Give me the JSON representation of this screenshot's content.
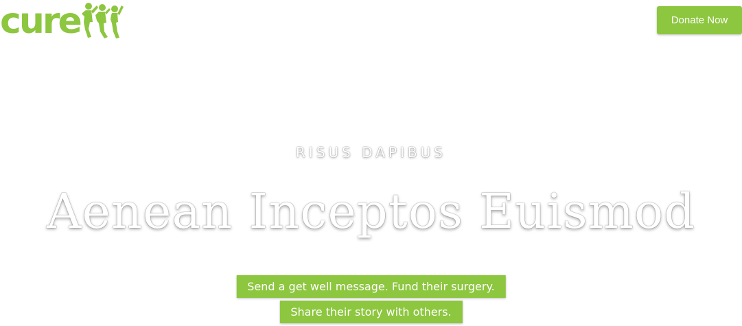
{
  "header": {
    "logo_text": "cure",
    "donate_label": "Donate Now"
  },
  "hero": {
    "kicker": "RISUS DAPIBUS",
    "title": "Aenean Inceptos Euismod",
    "cta_primary": "Send a get well message. Fund their surgery.",
    "cta_secondary": "Share their story with others."
  },
  "colors": {
    "brand_green": "#8dc63f",
    "text_white": "#ffffff"
  },
  "icons": {
    "logo_figures": "children-figures-icon"
  }
}
